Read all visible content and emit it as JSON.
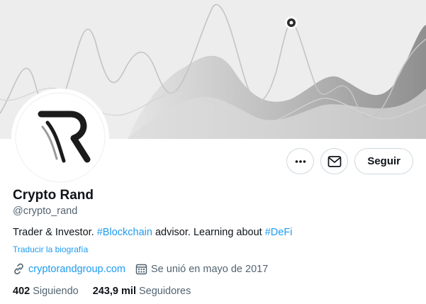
{
  "profile": {
    "name": "Crypto Rand",
    "handle": "@crypto_rand",
    "avatar_letter": "R",
    "bio": {
      "part1": "Trader & Investor. ",
      "hashtag1": "#Blockchain",
      "part2": " advisor. Learning about ",
      "hashtag2": "#DeFi"
    },
    "translate_bio": "Traducir la biografía",
    "website": "cryptorandgroup.com",
    "joined": "Se unió en mayo de 2017",
    "following_count": "402",
    "following_label": "Siguiendo",
    "followers_count": "243,9 mil",
    "followers_label": "Seguidores"
  },
  "actions": {
    "more_icon": "more-icon",
    "message_icon": "envelope-icon",
    "follow_label": "Seguir"
  },
  "colors": {
    "accent": "#1d9bf0",
    "text": "#0f1419",
    "secondary": "#536471",
    "border": "#cfd9de"
  }
}
